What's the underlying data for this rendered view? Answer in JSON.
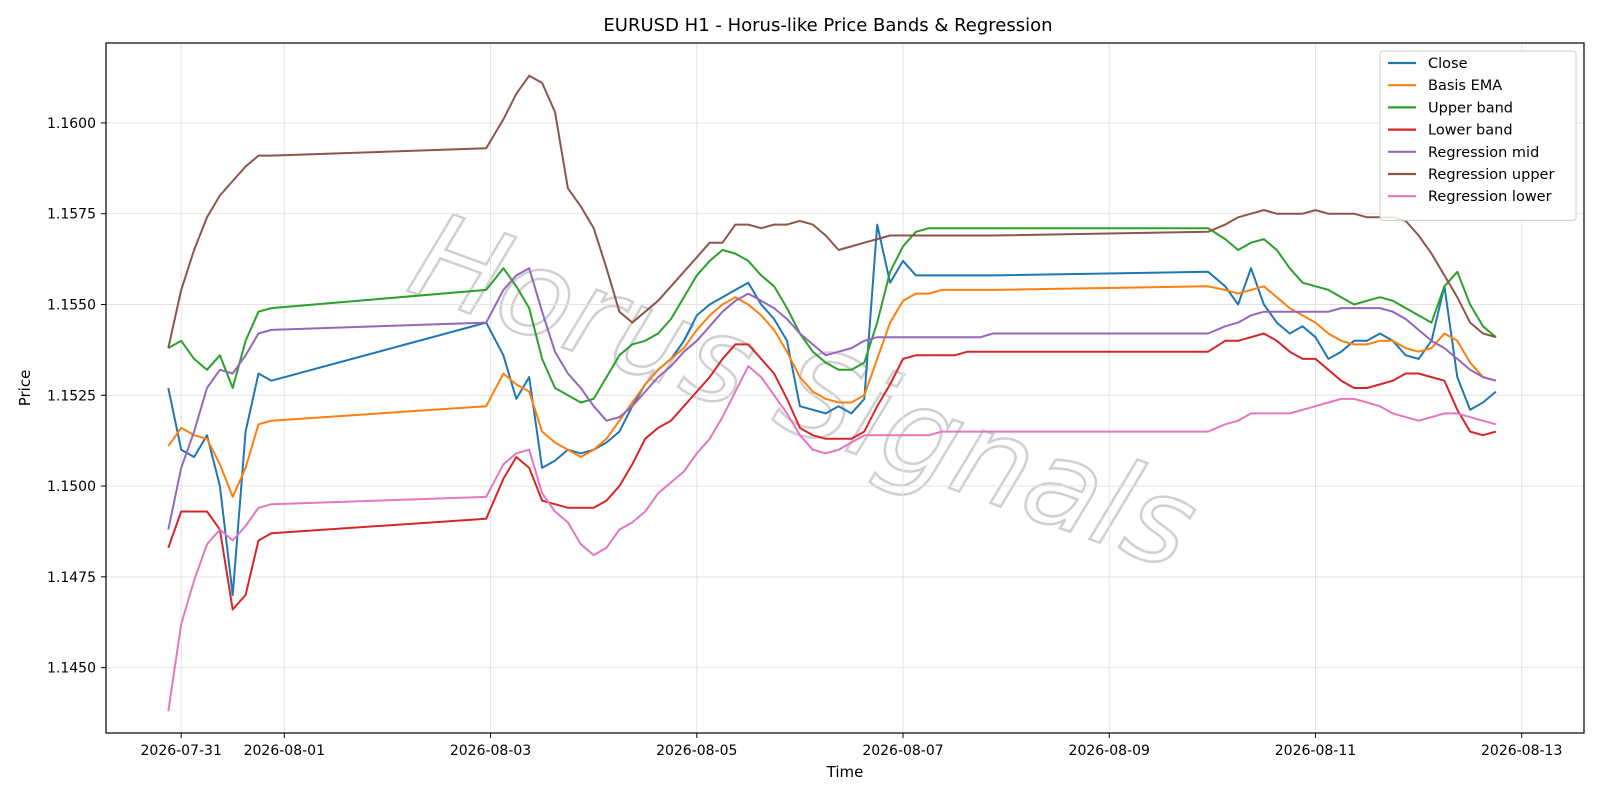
{
  "chart_data": {
    "type": "line",
    "title": "EURUSD H1 - Horus-like Price Bands & Regression",
    "xlabel": "Time",
    "ylabel": "Price",
    "watermark": "Horus Signals",
    "grid": true,
    "legend_position": "top-right",
    "xlim": [
      "2026-07-30 06:30",
      "2026-08-13 14:30"
    ],
    "ylim": [
      1.1432,
      1.1622
    ],
    "x_ticks": [
      "2026-07-31",
      "2026-08-01",
      "2026-08-03",
      "2026-08-05",
      "2026-08-07",
      "2026-08-09",
      "2026-08-11",
      "2026-08-13"
    ],
    "y_ticks": [
      "1.1450",
      "1.1475",
      "1.1500",
      "1.1525",
      "1.1550",
      "1.1575",
      "1.1600"
    ],
    "x": [
      "2026-07-30 21:00",
      "2026-07-31 00:00",
      "2026-07-31 03:00",
      "2026-07-31 06:00",
      "2026-07-31 09:00",
      "2026-07-31 12:00",
      "2026-07-31 15:00",
      "2026-07-31 18:00",
      "2026-07-31 21:00",
      "2026-08-02 23:00",
      "2026-08-03 03:00",
      "2026-08-03 06:00",
      "2026-08-03 09:00",
      "2026-08-03 12:00",
      "2026-08-03 15:00",
      "2026-08-03 18:00",
      "2026-08-03 21:00",
      "2026-08-04 00:00",
      "2026-08-04 03:00",
      "2026-08-04 06:00",
      "2026-08-04 09:00",
      "2026-08-04 12:00",
      "2026-08-04 15:00",
      "2026-08-04 18:00",
      "2026-08-04 21:00",
      "2026-08-05 00:00",
      "2026-08-05 03:00",
      "2026-08-05 06:00",
      "2026-08-05 09:00",
      "2026-08-05 12:00",
      "2026-08-05 15:00",
      "2026-08-05 18:00",
      "2026-08-05 21:00",
      "2026-08-06 00:00",
      "2026-08-06 03:00",
      "2026-08-06 06:00",
      "2026-08-06 09:00",
      "2026-08-06 12:00",
      "2026-08-06 15:00",
      "2026-08-06 18:00",
      "2026-08-06 21:00",
      "2026-08-07 00:00",
      "2026-08-07 03:00",
      "2026-08-07 06:00",
      "2026-08-07 09:00",
      "2026-08-07 12:00",
      "2026-08-07 15:00",
      "2026-08-07 18:00",
      "2026-08-07 21:00",
      "2026-08-09 23:00",
      "2026-08-10 03:00",
      "2026-08-10 06:00",
      "2026-08-10 09:00",
      "2026-08-10 12:00",
      "2026-08-10 15:00",
      "2026-08-10 18:00",
      "2026-08-10 21:00",
      "2026-08-11 00:00",
      "2026-08-11 03:00",
      "2026-08-11 06:00",
      "2026-08-11 09:00",
      "2026-08-11 12:00",
      "2026-08-11 15:00",
      "2026-08-11 18:00",
      "2026-08-11 21:00",
      "2026-08-12 00:00",
      "2026-08-12 03:00",
      "2026-08-12 06:00",
      "2026-08-12 09:00",
      "2026-08-12 12:00",
      "2026-08-12 15:00",
      "2026-08-12 18:00",
      "2026-08-12 21:00",
      "2026-08-13 00:00"
    ],
    "series": [
      {
        "name": "Close",
        "color": "#1f77b4",
        "values": [
          1.1527,
          1.151,
          1.1508,
          1.1514,
          1.15,
          1.147,
          1.1515,
          1.1531,
          1.1529,
          1.1545,
          1.1536,
          1.1524,
          1.153,
          1.1505,
          1.1507,
          1.151,
          1.1509,
          1.151,
          1.1512,
          1.1515,
          1.1522,
          1.1528,
          1.1532,
          1.1535,
          1.154,
          1.1547,
          1.155,
          1.1552,
          1.1554,
          1.1556,
          1.155,
          1.1546,
          1.154,
          1.1522,
          1.1521,
          1.152,
          1.1522,
          1.152,
          1.1524,
          1.1572,
          1.1556,
          1.1562,
          1.1558,
          1.1558,
          1.1558,
          1.1558,
          1.1558,
          1.1558,
          1.1558,
          1.1559,
          1.1555,
          1.155,
          1.156,
          1.155,
          1.1545,
          1.1542,
          1.1544,
          1.1541,
          1.1535,
          1.1537,
          1.154,
          1.154,
          1.1542,
          1.154,
          1.1536,
          1.1535,
          1.154,
          1.1555,
          1.153,
          1.1521,
          1.1523,
          1.1526
        ]
      },
      {
        "name": "Basis EMA",
        "color": "#ff7f0e",
        "values": [
          1.1511,
          1.1516,
          1.1514,
          1.1513,
          1.1506,
          1.1497,
          1.1505,
          1.1517,
          1.1518,
          1.1522,
          1.1531,
          1.1528,
          1.1526,
          1.1515,
          1.1512,
          1.151,
          1.1508,
          1.151,
          1.1513,
          1.1518,
          1.1523,
          1.1528,
          1.1532,
          1.1535,
          1.1538,
          1.1543,
          1.1547,
          1.155,
          1.1552,
          1.155,
          1.1547,
          1.1543,
          1.1537,
          1.153,
          1.1526,
          1.1524,
          1.1523,
          1.1523,
          1.1525,
          1.1535,
          1.1545,
          1.1551,
          1.1553,
          1.1553,
          1.1554,
          1.1554,
          1.1554,
          1.1554,
          1.1554,
          1.1555,
          1.1554,
          1.1553,
          1.1554,
          1.1555,
          1.1552,
          1.1549,
          1.1547,
          1.1545,
          1.1542,
          1.154,
          1.1539,
          1.1539,
          1.154,
          1.154,
          1.1538,
          1.1537,
          1.1538,
          1.1542,
          1.154,
          1.1534,
          1.153,
          1.1529
        ]
      },
      {
        "name": "Upper band",
        "color": "#2ca02c",
        "values": [
          1.1538,
          1.154,
          1.1535,
          1.1532,
          1.1536,
          1.1527,
          1.154,
          1.1548,
          1.1549,
          1.1554,
          1.156,
          1.1555,
          1.1549,
          1.1535,
          1.1527,
          1.1525,
          1.1523,
          1.1524,
          1.153,
          1.1536,
          1.1539,
          1.154,
          1.1542,
          1.1546,
          1.1552,
          1.1558,
          1.1562,
          1.1565,
          1.1564,
          1.1562,
          1.1558,
          1.1555,
          1.1549,
          1.1542,
          1.1537,
          1.1534,
          1.1532,
          1.1532,
          1.1534,
          1.1545,
          1.1559,
          1.1566,
          1.157,
          1.1571,
          1.1571,
          1.1571,
          1.1571,
          1.1571,
          1.1571,
          1.1571,
          1.1568,
          1.1565,
          1.1567,
          1.1568,
          1.1565,
          1.156,
          1.1556,
          1.1555,
          1.1554,
          1.1552,
          1.155,
          1.1551,
          1.1552,
          1.1551,
          1.1549,
          1.1547,
          1.1545,
          1.1555,
          1.1559,
          1.155,
          1.1544,
          1.1541
        ]
      },
      {
        "name": "Lower band",
        "color": "#d62728",
        "values": [
          1.1483,
          1.1493,
          1.1493,
          1.1493,
          1.1488,
          1.1466,
          1.147,
          1.1485,
          1.1487,
          1.1491,
          1.1502,
          1.1508,
          1.1505,
          1.1496,
          1.1495,
          1.1494,
          1.1494,
          1.1494,
          1.1496,
          1.15,
          1.1506,
          1.1513,
          1.1516,
          1.1518,
          1.1522,
          1.1526,
          1.153,
          1.1535,
          1.1539,
          1.1539,
          1.1535,
          1.1531,
          1.1524,
          1.1516,
          1.1514,
          1.1513,
          1.1513,
          1.1513,
          1.1515,
          1.1522,
          1.1528,
          1.1535,
          1.1536,
          1.1536,
          1.1536,
          1.1536,
          1.1537,
          1.1537,
          1.1537,
          1.1537,
          1.154,
          1.154,
          1.1541,
          1.1542,
          1.154,
          1.1537,
          1.1535,
          1.1535,
          1.1532,
          1.1529,
          1.1527,
          1.1527,
          1.1528,
          1.1529,
          1.1531,
          1.1531,
          1.153,
          1.1529,
          1.1521,
          1.1515,
          1.1514,
          1.1515
        ]
      },
      {
        "name": "Regression mid",
        "color": "#9467bd",
        "values": [
          1.1488,
          1.1505,
          1.1515,
          1.1527,
          1.1532,
          1.1531,
          1.1536,
          1.1542,
          1.1543,
          1.1545,
          1.1554,
          1.1558,
          1.156,
          1.1548,
          1.1537,
          1.1531,
          1.1527,
          1.1522,
          1.1518,
          1.1519,
          1.1522,
          1.1526,
          1.153,
          1.1533,
          1.1537,
          1.154,
          1.1544,
          1.1548,
          1.1551,
          1.1553,
          1.1551,
          1.1549,
          1.1546,
          1.1542,
          1.1539,
          1.1536,
          1.1537,
          1.1538,
          1.154,
          1.1541,
          1.1541,
          1.1541,
          1.1541,
          1.1541,
          1.1541,
          1.1541,
          1.1541,
          1.1541,
          1.1542,
          1.1542,
          1.1544,
          1.1545,
          1.1547,
          1.1548,
          1.1548,
          1.1548,
          1.1548,
          1.1548,
          1.1548,
          1.1549,
          1.1549,
          1.1549,
          1.1549,
          1.1548,
          1.1546,
          1.1543,
          1.154,
          1.1538,
          1.1535,
          1.1532,
          1.153,
          1.1529
        ]
      },
      {
        "name": "Regression upper",
        "color": "#8c564b",
        "values": [
          1.1538,
          1.1554,
          1.1565,
          1.1574,
          1.158,
          1.1584,
          1.1588,
          1.1591,
          1.1591,
          1.1593,
          1.1601,
          1.1608,
          1.1613,
          1.1611,
          1.1603,
          1.1582,
          1.1577,
          1.1571,
          1.156,
          1.1548,
          1.1545,
          1.1548,
          1.1551,
          1.1555,
          1.1559,
          1.1563,
          1.1567,
          1.1567,
          1.1572,
          1.1572,
          1.1571,
          1.1572,
          1.1572,
          1.1573,
          1.1572,
          1.1569,
          1.1565,
          1.1566,
          1.1567,
          1.1568,
          1.1569,
          1.1569,
          1.1569,
          1.1569,
          1.1569,
          1.1569,
          1.1569,
          1.1569,
          1.1569,
          1.157,
          1.1572,
          1.1574,
          1.1575,
          1.1576,
          1.1575,
          1.1575,
          1.1575,
          1.1576,
          1.1575,
          1.1575,
          1.1575,
          1.1574,
          1.1574,
          1.1574,
          1.1573,
          1.1569,
          1.1564,
          1.1558,
          1.1552,
          1.1545,
          1.1542,
          1.1541
        ]
      },
      {
        "name": "Regression lower",
        "color": "#e377c2",
        "values": [
          1.1438,
          1.1462,
          1.1474,
          1.1484,
          1.1488,
          1.1485,
          1.1489,
          1.1494,
          1.1495,
          1.1497,
          1.1506,
          1.1509,
          1.151,
          1.1498,
          1.1493,
          1.149,
          1.1484,
          1.1481,
          1.1483,
          1.1488,
          1.149,
          1.1493,
          1.1498,
          1.1501,
          1.1504,
          1.1509,
          1.1513,
          1.1519,
          1.1526,
          1.1533,
          1.153,
          1.1525,
          1.152,
          1.1514,
          1.151,
          1.1509,
          1.151,
          1.1512,
          1.1514,
          1.1514,
          1.1514,
          1.1514,
          1.1514,
          1.1514,
          1.1515,
          1.1515,
          1.1515,
          1.1515,
          1.1515,
          1.1515,
          1.1517,
          1.1518,
          1.152,
          1.152,
          1.152,
          1.152,
          1.1521,
          1.1522,
          1.1523,
          1.1524,
          1.1524,
          1.1523,
          1.1522,
          1.152,
          1.1519,
          1.1518,
          1.1519,
          1.152,
          1.152,
          1.1519,
          1.1518,
          1.1517
        ]
      }
    ]
  }
}
